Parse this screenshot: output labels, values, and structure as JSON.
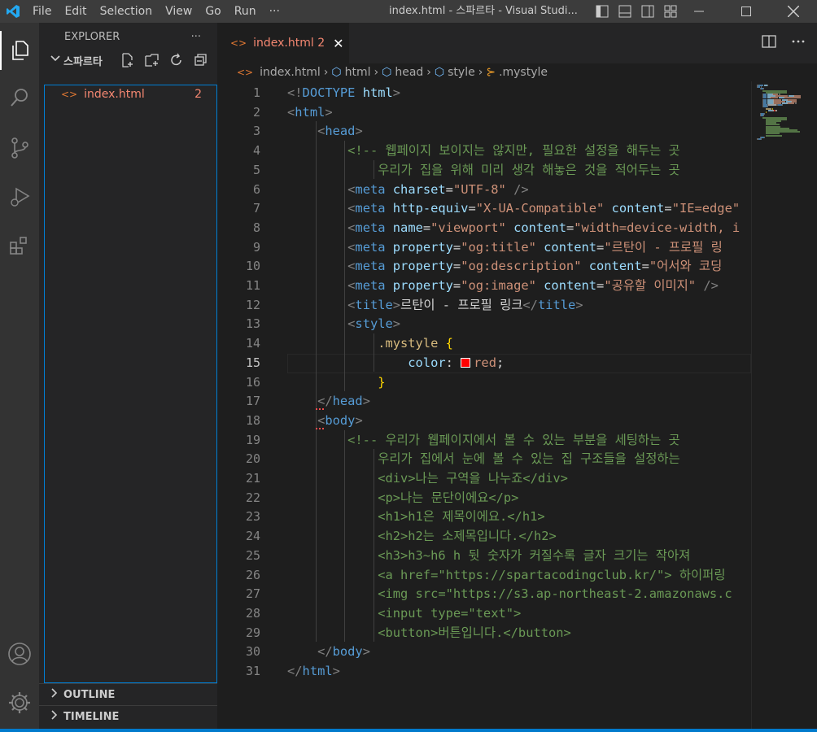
{
  "window": {
    "title": "index.html - 스파르타 - Visual Studi...",
    "menu": [
      "File",
      "Edit",
      "Selection",
      "View",
      "Go",
      "Run",
      "···"
    ]
  },
  "sidebar": {
    "header": "EXPLORER",
    "header_more": "···",
    "folder": "스파르타",
    "files": [
      {
        "name": "index.html",
        "badge": "2"
      }
    ],
    "sections": [
      "OUTLINE",
      "TIMELINE"
    ]
  },
  "editor": {
    "tab": {
      "label": "index.html 2"
    },
    "breadcrumb": [
      "index.html",
      "html",
      "head",
      "style",
      ".mystyle"
    ],
    "current_line": 15,
    "lines": [
      [
        [
          "tp",
          "<!"
        ],
        [
          "t",
          "DOCTYPE"
        ],
        [
          "tx",
          " "
        ],
        [
          "a",
          "html"
        ],
        [
          "tp",
          ">"
        ]
      ],
      [
        [
          "tp",
          "<"
        ],
        [
          "t",
          "html"
        ],
        [
          "tp",
          ">"
        ]
      ],
      [
        [
          "tx",
          "    "
        ],
        [
          "tp",
          "<"
        ],
        [
          "t",
          "head"
        ],
        [
          "tp",
          ">"
        ]
      ],
      [
        [
          "tx",
          "        "
        ],
        [
          "c",
          "<!-- 웹페이지 보이지는 않지만, 필요한 설정을 해두는 곳"
        ]
      ],
      [
        [
          "tx",
          "            "
        ],
        [
          "c",
          "우리가 집을 위해 미리 생각 해놓은 것을 적어두는 곳"
        ]
      ],
      [
        [
          "tx",
          "        "
        ],
        [
          "tp",
          "<"
        ],
        [
          "t",
          "meta"
        ],
        [
          "tx",
          " "
        ],
        [
          "a",
          "charset"
        ],
        [
          "tx",
          "="
        ],
        [
          "s",
          "\"UTF-8\""
        ],
        [
          "tx",
          " "
        ],
        [
          "tp",
          "/>"
        ]
      ],
      [
        [
          "tx",
          "        "
        ],
        [
          "tp",
          "<"
        ],
        [
          "t",
          "meta"
        ],
        [
          "tx",
          " "
        ],
        [
          "a",
          "http-equiv"
        ],
        [
          "tx",
          "="
        ],
        [
          "s",
          "\"X-UA-Compatible\""
        ],
        [
          "tx",
          " "
        ],
        [
          "a",
          "content"
        ],
        [
          "tx",
          "="
        ],
        [
          "s",
          "\"IE=edge\""
        ]
      ],
      [
        [
          "tx",
          "        "
        ],
        [
          "tp",
          "<"
        ],
        [
          "t",
          "meta"
        ],
        [
          "tx",
          " "
        ],
        [
          "a",
          "name"
        ],
        [
          "tx",
          "="
        ],
        [
          "s",
          "\"viewport\""
        ],
        [
          "tx",
          " "
        ],
        [
          "a",
          "content"
        ],
        [
          "tx",
          "="
        ],
        [
          "s",
          "\"width=device-width, i"
        ]
      ],
      [
        [
          "tx",
          "        "
        ],
        [
          "tp",
          "<"
        ],
        [
          "t",
          "meta"
        ],
        [
          "tx",
          " "
        ],
        [
          "a",
          "property"
        ],
        [
          "tx",
          "="
        ],
        [
          "s",
          "\"og:title\""
        ],
        [
          "tx",
          " "
        ],
        [
          "a",
          "content"
        ],
        [
          "tx",
          "="
        ],
        [
          "s",
          "\"르탄이 - 프로필 링"
        ]
      ],
      [
        [
          "tx",
          "        "
        ],
        [
          "tp",
          "<"
        ],
        [
          "t",
          "meta"
        ],
        [
          "tx",
          " "
        ],
        [
          "a",
          "property"
        ],
        [
          "tx",
          "="
        ],
        [
          "s",
          "\"og:description\""
        ],
        [
          "tx",
          " "
        ],
        [
          "a",
          "content"
        ],
        [
          "tx",
          "="
        ],
        [
          "s",
          "\"어서와 코딩"
        ]
      ],
      [
        [
          "tx",
          "        "
        ],
        [
          "tp",
          "<"
        ],
        [
          "t",
          "meta"
        ],
        [
          "tx",
          " "
        ],
        [
          "a",
          "property"
        ],
        [
          "tx",
          "="
        ],
        [
          "s",
          "\"og:image\""
        ],
        [
          "tx",
          " "
        ],
        [
          "a",
          "content"
        ],
        [
          "tx",
          "="
        ],
        [
          "s",
          "\"공유할 이미지\""
        ],
        [
          "tx",
          " "
        ],
        [
          "tp",
          "/>"
        ]
      ],
      [
        [
          "tx",
          "        "
        ],
        [
          "tp",
          "<"
        ],
        [
          "t",
          "title"
        ],
        [
          "tp",
          ">"
        ],
        [
          "tx",
          "르탄이 - 프로필 링크"
        ],
        [
          "tp",
          "</"
        ],
        [
          "t",
          "title"
        ],
        [
          "tp",
          ">"
        ]
      ],
      [
        [
          "tx",
          "        "
        ],
        [
          "tp",
          "<"
        ],
        [
          "t",
          "style"
        ],
        [
          "tp",
          ">"
        ]
      ],
      [
        [
          "tx",
          "            "
        ],
        [
          "sel",
          ".mystyle"
        ],
        [
          "tx",
          " "
        ],
        [
          "br",
          "{"
        ]
      ],
      [
        [
          "tx",
          "                "
        ],
        [
          "a",
          "color"
        ],
        [
          "tx",
          ": "
        ],
        [
          "swatch",
          ""
        ],
        [
          "s",
          "red"
        ],
        [
          "tx",
          ";"
        ]
      ],
      [
        [
          "tx",
          "            "
        ],
        [
          "br",
          "}"
        ]
      ],
      [
        [
          "tx",
          "    "
        ],
        [
          "tp",
          "</"
        ],
        [
          "t",
          "head"
        ],
        [
          "tp",
          ">"
        ]
      ],
      [
        [
          "tx",
          "    "
        ],
        [
          "tp",
          "<"
        ],
        [
          "t",
          "body"
        ],
        [
          "tp",
          ">"
        ]
      ],
      [
        [
          "tx",
          "        "
        ],
        [
          "c",
          "<!-- 우리가 웹페이지에서 볼 수 있는 부분을 세팅하는 곳"
        ]
      ],
      [
        [
          "tx",
          "            "
        ],
        [
          "c",
          "우리가 집에서 눈에 볼 수 있는 집 구조들을 설정하는"
        ]
      ],
      [
        [
          "tx",
          "            "
        ],
        [
          "c",
          "<div>나는 구역을 나누죠</div>"
        ]
      ],
      [
        [
          "tx",
          "            "
        ],
        [
          "c",
          "<p>나는 문단이에요</p>"
        ]
      ],
      [
        [
          "tx",
          "            "
        ],
        [
          "c",
          "<h1>h1은 제목이에요.</h1>"
        ]
      ],
      [
        [
          "tx",
          "            "
        ],
        [
          "c",
          "<h2>h2는 소제목입니다.</h2>"
        ]
      ],
      [
        [
          "tx",
          "            "
        ],
        [
          "c",
          "<h3>h3~h6 h 뒷 숫자가 커질수록 글자 크기는 작아져"
        ]
      ],
      [
        [
          "tx",
          "            "
        ],
        [
          "c",
          "<a href=\"https://spartacodingclub.kr/\"> 하이퍼링"
        ]
      ],
      [
        [
          "tx",
          "            "
        ],
        [
          "c",
          "<img src=\"https://s3.ap-northeast-2.amazonaws.c"
        ]
      ],
      [
        [
          "tx",
          "            "
        ],
        [
          "c",
          "<input type=\"text\">"
        ]
      ],
      [
        [
          "tx",
          "            "
        ],
        [
          "c",
          "<button>버튼입니다.</button>"
        ]
      ],
      [
        [
          "tx",
          "    "
        ],
        [
          "tp",
          "</"
        ],
        [
          "t",
          "body"
        ],
        [
          "tp",
          ">"
        ]
      ],
      [
        [
          "tp",
          "</"
        ],
        [
          "t",
          "html"
        ],
        [
          "tp",
          ">"
        ]
      ]
    ]
  },
  "colors": {
    "accent": "#007acc",
    "error": "#f48771",
    "html_icon": "#e37933",
    "swatch": "#ff0000"
  },
  "icons": {
    "activity": [
      "explorer-icon",
      "search-icon",
      "source-control-icon",
      "run-debug-icon",
      "extensions-icon",
      "accounts-icon",
      "settings-gear-icon"
    ]
  }
}
